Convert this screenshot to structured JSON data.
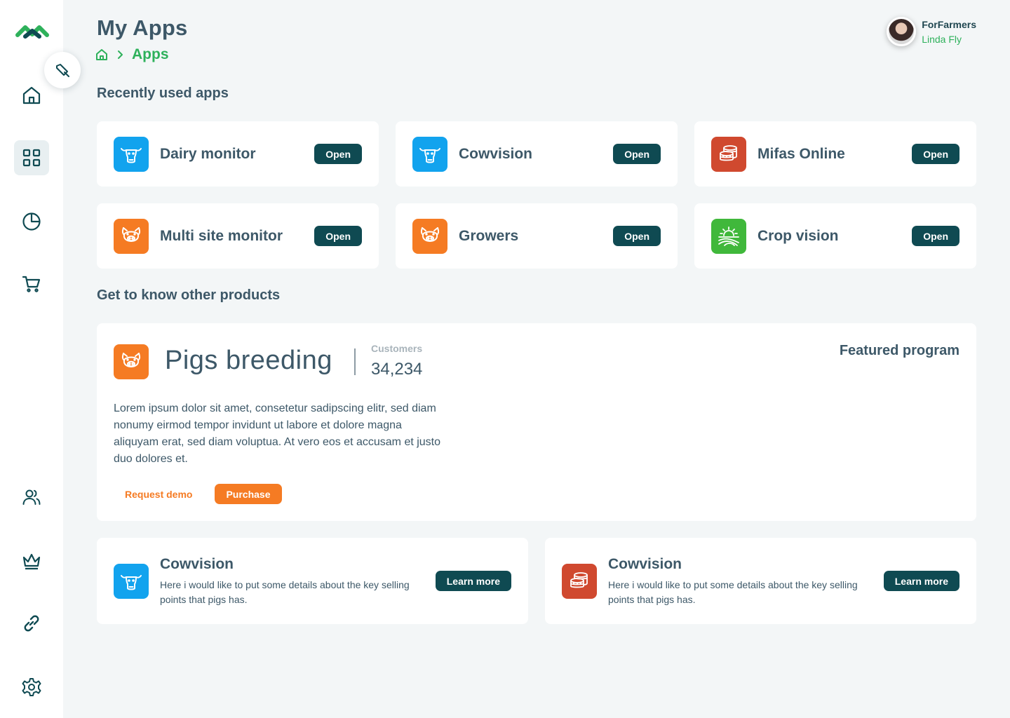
{
  "colors": {
    "accent_green": "#2eb15b",
    "dark_teal": "#0f4a52",
    "orange": "#f57b23",
    "blue": "#12a3ee",
    "red": "#d0492f",
    "green": "#40b83b"
  },
  "sidebar": {
    "items": [
      {
        "icon": "home-icon"
      },
      {
        "icon": "apps-grid-icon",
        "active": true
      },
      {
        "icon": "pie-chart-icon"
      },
      {
        "icon": "cart-icon"
      },
      {
        "icon": "users-icon"
      },
      {
        "icon": "crown-icon"
      },
      {
        "icon": "link-icon"
      },
      {
        "icon": "settings-icon"
      }
    ]
  },
  "header": {
    "title": "My Apps",
    "breadcrumb": {
      "home_icon": "home-icon",
      "current": "Apps"
    },
    "user": {
      "organization": "ForFarmers",
      "name": "Linda Fly"
    }
  },
  "recent": {
    "title": "Recently used apps",
    "apps": [
      {
        "name": "Dairy monitor",
        "icon": "cow-icon",
        "button": "Open"
      },
      {
        "name": "Cowvision",
        "icon": "cow-icon",
        "button": "Open"
      },
      {
        "name": "Mifas Online",
        "icon": "coins-icon",
        "button": "Open"
      },
      {
        "name": "Multi site monitor",
        "icon": "pig-icon",
        "button": "Open"
      },
      {
        "name": "Growers",
        "icon": "pig-icon",
        "button": "Open"
      },
      {
        "name": "Crop vision",
        "icon": "sun-field-icon",
        "button": "Open"
      }
    ]
  },
  "products": {
    "title": "Get to know other products",
    "featured": {
      "name": "Pigs breeding",
      "icon": "pig-icon",
      "customers_label": "Customers",
      "customers_value": "34,234",
      "tag": "Featured program",
      "description": "Lorem ipsum dolor sit amet, consetetur sadipscing elitr, sed diam nonumy eirmod tempor invidunt ut labore et dolore magna aliquyam erat, sed diam voluptua. At vero eos et accusam et justo duo dolores et.",
      "secondary_action": "Request demo",
      "primary_action": "Purchase"
    },
    "promos": [
      {
        "title": "Cowvision",
        "icon": "cow-icon",
        "description": "Here i would like to put some details about the key selling points that pigs has.",
        "button": "Learn more"
      },
      {
        "title": "Cowvision",
        "icon": "coins-icon",
        "description": "Here i would like to put some details about the key selling points that pigs has.",
        "button": "Learn more"
      }
    ]
  }
}
